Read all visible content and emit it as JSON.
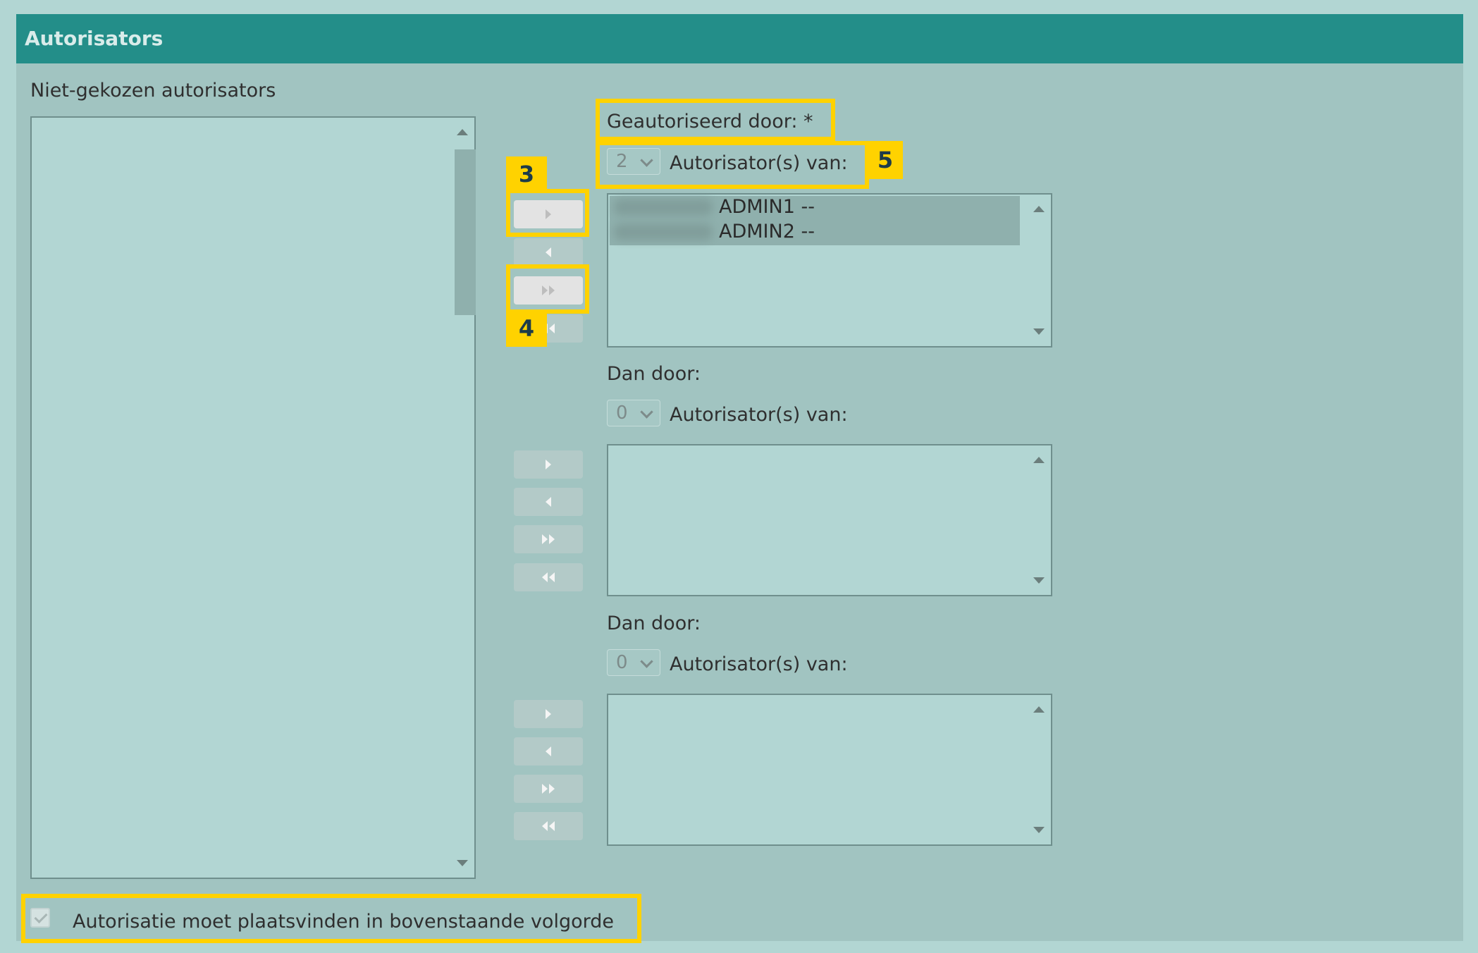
{
  "header": {
    "title": "Autorisators"
  },
  "left_list": {
    "label": "Niet-gekozen autorisators",
    "items": []
  },
  "groups": [
    {
      "label": "Geautoriseerd door: *",
      "count": "2",
      "count_label": "Autorisator(s) van:",
      "items": [
        "ADMIN1 --",
        "ADMIN2 --"
      ]
    },
    {
      "label": "Dan door:",
      "count": "0",
      "count_label": "Autorisator(s) van:",
      "items": []
    },
    {
      "label": "Dan door:",
      "count": "0",
      "count_label": "Autorisator(s) van:",
      "items": []
    }
  ],
  "checkbox": {
    "label": "Autorisatie moet plaatsvinden in bovenstaande volgorde",
    "checked": true
  },
  "annotations": {
    "badge_3": "3",
    "badge_4": "4",
    "badge_5": "5",
    "highlight_color": "#ffd200"
  },
  "colors": {
    "header": "#238e89",
    "panel": "#a1c4c1",
    "listbox": "#b2d6d3"
  }
}
